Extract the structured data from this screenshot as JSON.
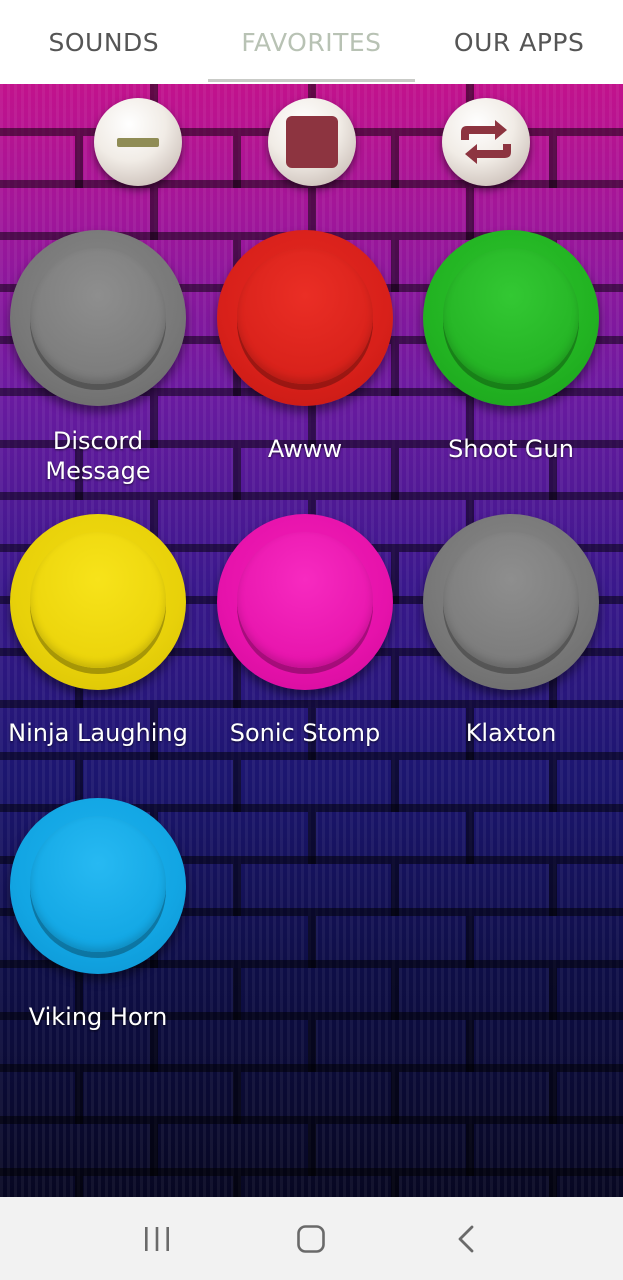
{
  "tabs": [
    {
      "label": "SOUNDS",
      "active": false
    },
    {
      "label": "FAVORITES",
      "active": true
    },
    {
      "label": "OUR APPS",
      "active": false
    }
  ],
  "controls": [
    {
      "icon": "minus-icon"
    },
    {
      "icon": "stop-icon"
    },
    {
      "icon": "repeat-icon"
    }
  ],
  "sounds": [
    {
      "label": "Discord Message",
      "color": "gray"
    },
    {
      "label": "Awww",
      "color": "red"
    },
    {
      "label": "Shoot Gun",
      "color": "green"
    },
    {
      "label": "Ninja Laughing",
      "color": "yellow"
    },
    {
      "label": "Sonic Stomp",
      "color": "pink"
    },
    {
      "label": "Klaxton",
      "color": "gray"
    },
    {
      "label": "Viking Horn",
      "color": "blue"
    }
  ],
  "navbar": {
    "icons": [
      "recent-apps-icon",
      "home-icon",
      "back-icon"
    ]
  }
}
